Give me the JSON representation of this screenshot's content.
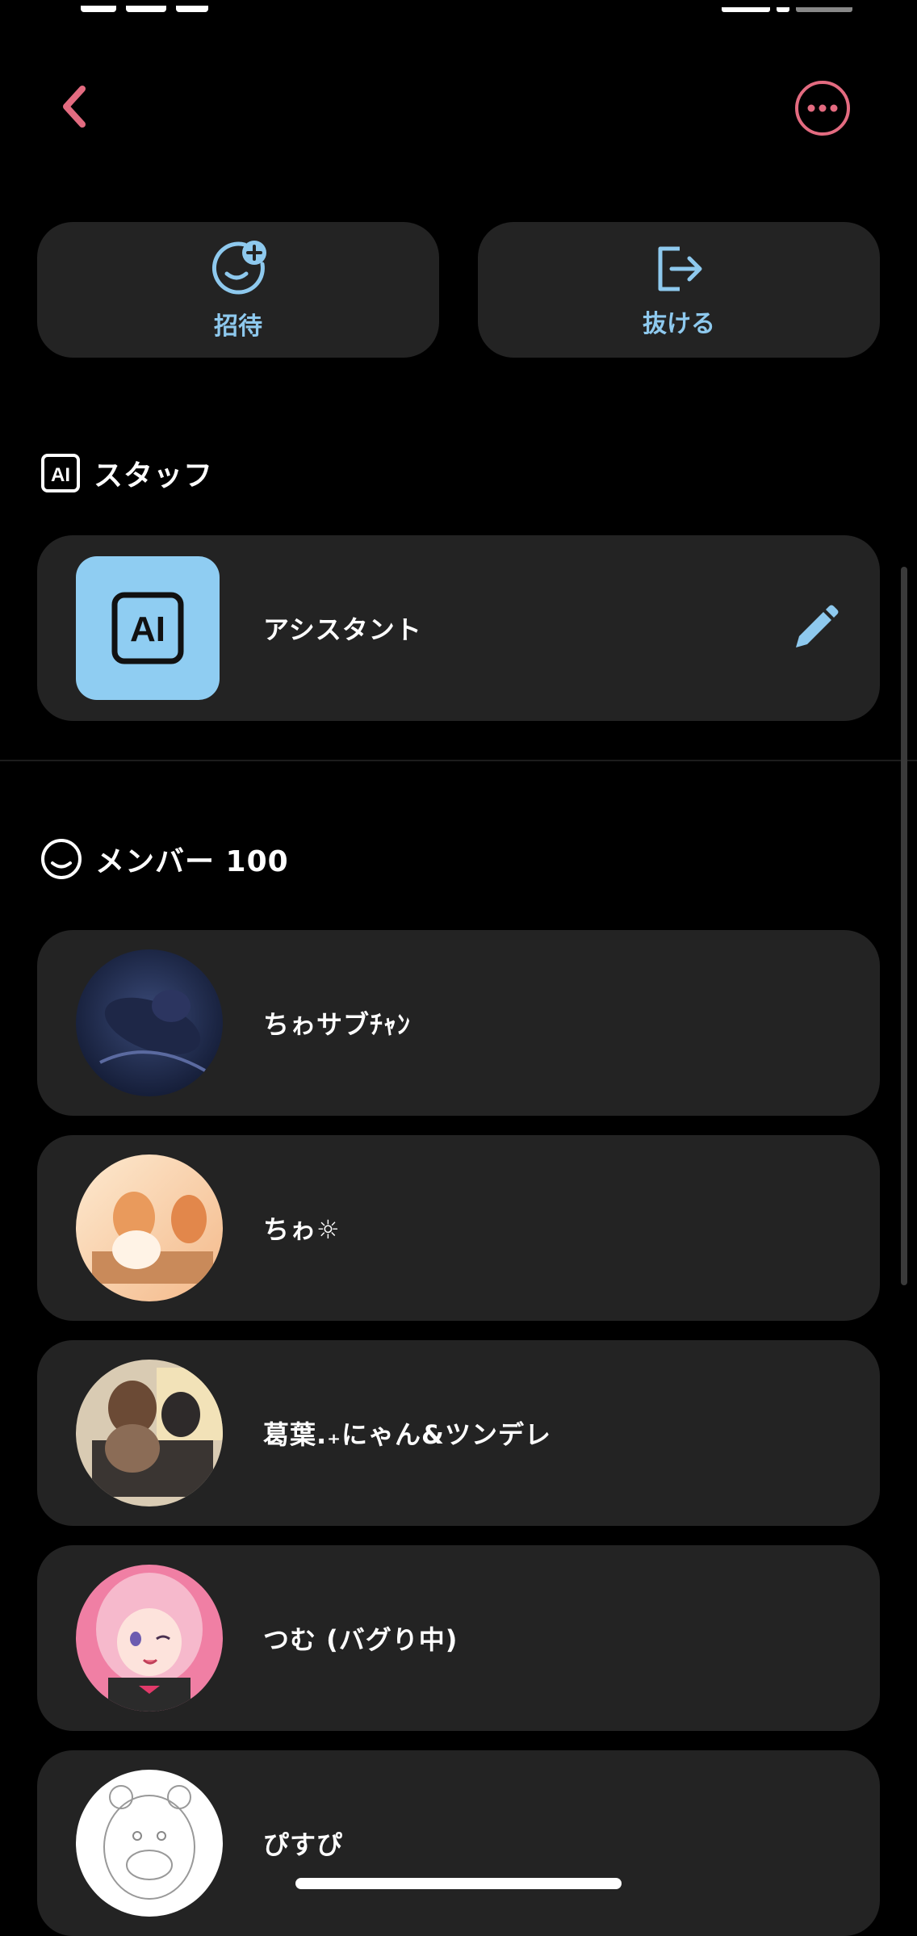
{
  "header": {
    "back_icon": "chevron-left-icon",
    "more_icon": "more-horizontal-circle-icon",
    "accent_color": "#e36b80"
  },
  "actions": {
    "invite_label": "招待",
    "invite_icon": "add-smile-icon",
    "leave_label": "抜ける",
    "leave_icon": "exit-icon",
    "accent_color": "#8ec9ee"
  },
  "staff": {
    "title": "スタッフ",
    "icon": "ai-badge-icon",
    "items": [
      {
        "name": "アシスタント",
        "edit_icon": "pencil-icon"
      }
    ]
  },
  "members": {
    "title": "メンバー 100",
    "icon": "smile-outline-icon",
    "items": [
      {
        "name": "ちゎサブﾁｬﾝ"
      },
      {
        "name": "ちゎ☼"
      },
      {
        "name": "葛葉.₊にゃん&ツンデレ"
      },
      {
        "name": "つむ (バグり中)"
      },
      {
        "name": "ぴすぴ"
      }
    ]
  }
}
